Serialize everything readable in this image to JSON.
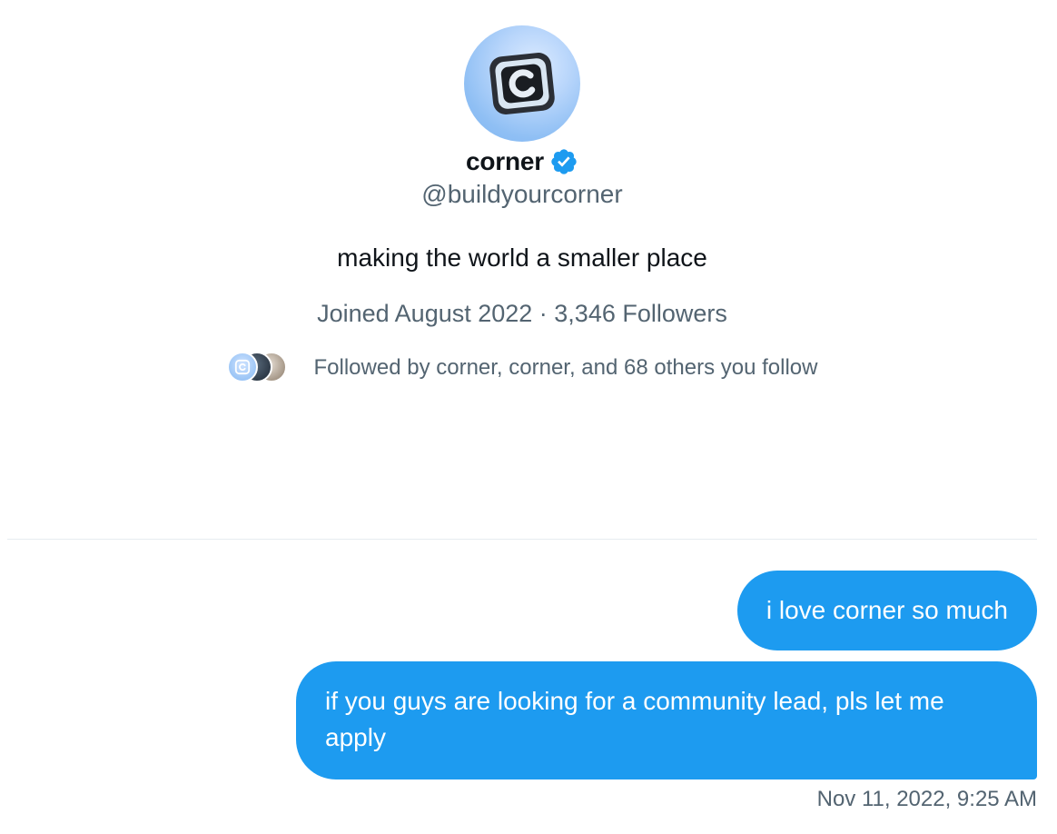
{
  "profile": {
    "display_name": "corner",
    "handle": "@buildyourcorner",
    "bio": "making the world a smaller place",
    "meta": "Joined August 2022 · 3,346 Followers",
    "followed_by": "Followed by corner, corner, and 68 others you follow",
    "avatar_icon": "corner-logo-icon",
    "verified_color": "#1d9bf0"
  },
  "messages": [
    {
      "text": "i love corner so much"
    },
    {
      "text": "if you guys are looking for a community lead, pls let me apply"
    }
  ],
  "timestamp": "Nov 11, 2022, 9:25 AM",
  "colors": {
    "accent": "#1d9bf0",
    "secondary_text": "#536471",
    "primary_text": "#0f1419"
  }
}
